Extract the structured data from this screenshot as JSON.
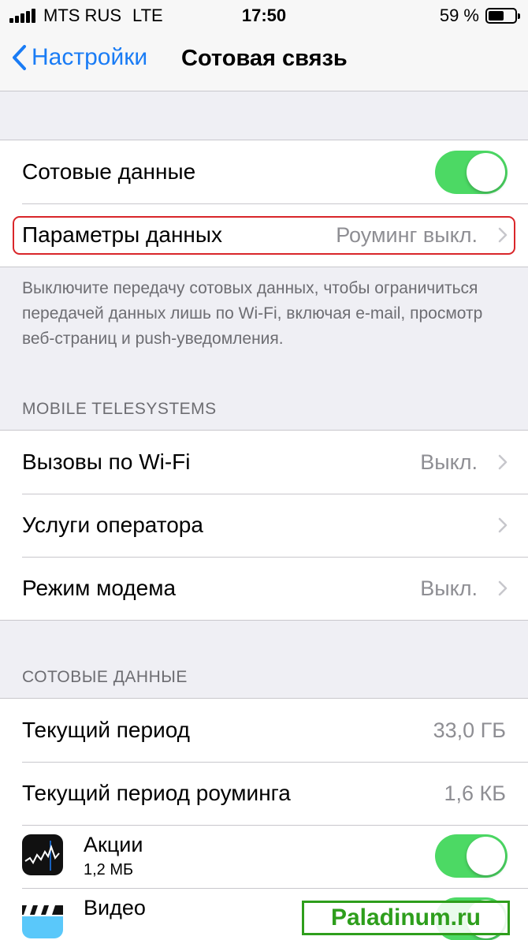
{
  "status_bar": {
    "carrier": "MTS RUS",
    "network": "LTE",
    "time": "17:50",
    "battery_percent": "59 %",
    "battery_level": 0.59
  },
  "nav": {
    "back_label": "Настройки",
    "title": "Сотовая связь"
  },
  "cellular": {
    "cellular_data_label": "Сотовые данные",
    "cellular_data_on": true,
    "data_options_label": "Параметры данных",
    "data_options_value": "Роуминг выкл.",
    "footer_note": "Выключите передачу сотовых данных, чтобы ограничиться передачей данных лишь по Wi-Fi, включая e-mail, просмотр веб-страниц и push-уведомления."
  },
  "carrier_section": {
    "header": "MOBILE TELESYSTEMS",
    "items": [
      {
        "label": "Вызовы по Wi-Fi",
        "value": "Выкл."
      },
      {
        "label": "Услуги оператора",
        "value": ""
      },
      {
        "label": "Режим модема",
        "value": "Выкл."
      }
    ]
  },
  "usage_section": {
    "header": "СОТОВЫЕ ДАННЫЕ",
    "current_period_label": "Текущий период",
    "current_period_value": "33,0 ГБ",
    "roaming_period_label": "Текущий период роуминга",
    "roaming_period_value": "1,6 КБ",
    "apps": [
      {
        "name": "Акции",
        "size": "1,2 МБ",
        "icon": "stocks-icon",
        "enabled": true
      },
      {
        "name": "Видео",
        "size": "",
        "icon": "videos-icon",
        "enabled": true
      }
    ]
  },
  "watermark": "Paladinum.ru",
  "colors": {
    "accent": "#1a7cf5",
    "toggle_on": "#4cd964",
    "highlight": "#d9262a",
    "watermark": "#2e9e1c"
  }
}
